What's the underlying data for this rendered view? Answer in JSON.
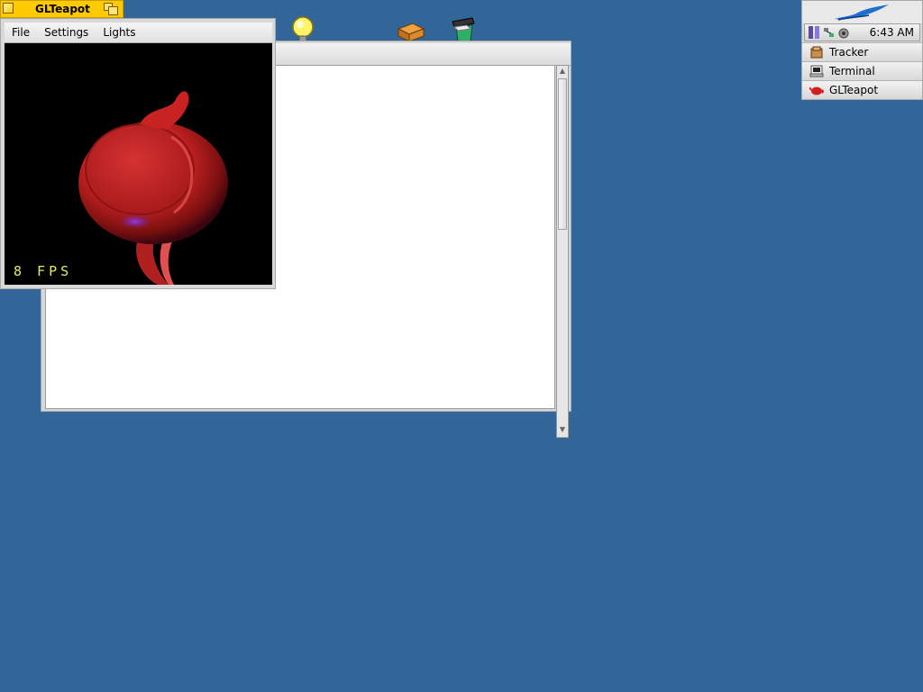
{
  "gl_window": {
    "title": "GLTeapot",
    "menu": [
      "File",
      "Settings",
      "Lights"
    ],
    "fps_text": "8 FPS"
  },
  "deskbar": {
    "clock": "6:43 AM",
    "teams": [
      {
        "label": "Tracker",
        "icon": "tracker-icon"
      },
      {
        "label": "Terminal",
        "icon": "terminal-icon"
      },
      {
        "label": "GLTeapot",
        "icon": "teapot-icon"
      }
    ]
  },
  "colors": {
    "desktop": "#336698",
    "tab_yellow": "#ffcb00",
    "teapot_red": "#c62828"
  },
  "desktop_icons": [
    "lightbulb-icon",
    "package-icon",
    "trash-icon"
  ]
}
